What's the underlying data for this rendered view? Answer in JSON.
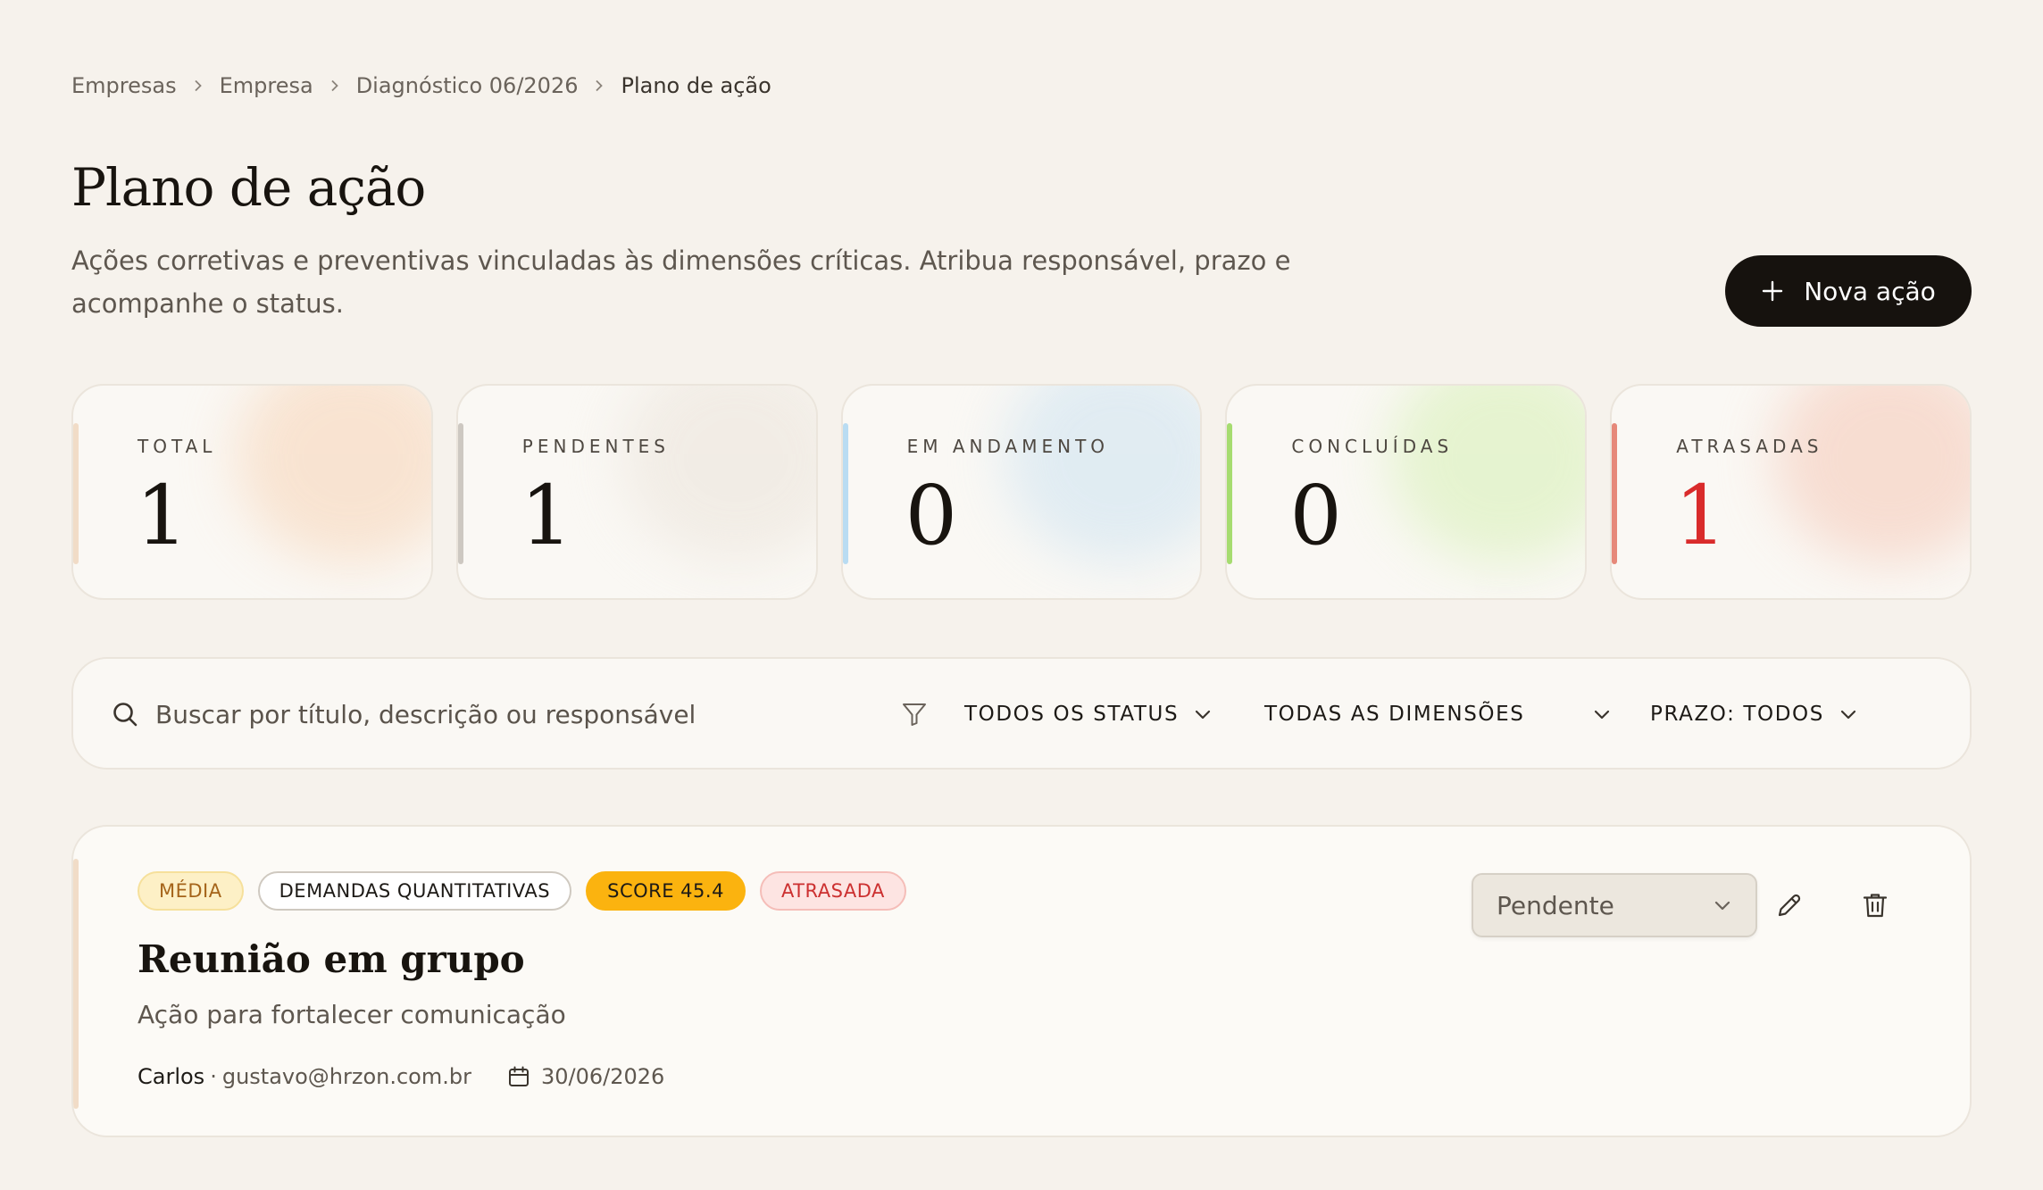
{
  "breadcrumb": {
    "items": [
      "Empresas",
      "Empresa",
      "Diagnóstico 06/2026",
      "Plano de ação"
    ]
  },
  "header": {
    "title": "Plano de ação",
    "subtitle": "Ações corretivas e preventivas vinculadas às dimensões críticas. Atribua responsável, prazo e acompanhe o status.",
    "new_action_label": "Nova ação",
    "new_action_icon": "plus-icon"
  },
  "stats": [
    {
      "label": "TOTAL",
      "value": "1",
      "accent": "#f1dcc7",
      "glow": "#f8ddc6",
      "value_color": "#18140f"
    },
    {
      "label": "PENDENTES",
      "value": "1",
      "accent": "#cdc8c1",
      "glow": "#efe9e1",
      "value_color": "#18140f"
    },
    {
      "label": "EM ANDAMENTO",
      "value": "0",
      "accent": "#b9dcf2",
      "glow": "#d8e8f2",
      "value_color": "#18140f"
    },
    {
      "label": "CONCLUÍDAS",
      "value": "0",
      "accent": "#a6dc70",
      "glow": "#dff2c4",
      "value_color": "#18140f"
    },
    {
      "label": "ATRASADAS",
      "value": "1",
      "accent": "#e6897a",
      "glow": "#f6d4c6",
      "value_color": "#d92b2b"
    }
  ],
  "filters": {
    "search_placeholder": "Buscar por título, descrição ou responsável",
    "search_value": "",
    "status_value": "TODOS OS STATUS",
    "dimension_value": "TODAS AS DIMENSÕES",
    "deadline_value": "PRAZO: TODOS"
  },
  "actions": [
    {
      "tags": {
        "priority": "MÉDIA",
        "dimension": "DEMANDAS QUANTITATIVAS",
        "score": "SCORE 45.4",
        "status_badge": "ATRASADA"
      },
      "title": "Reunião em grupo",
      "description": "Ação para fortalecer comunicação",
      "owner": "Carlos",
      "separator": "·",
      "email": "gustavo@hrzon.com.br",
      "due_date": "30/06/2026",
      "status_value": "Pendente"
    }
  ]
}
